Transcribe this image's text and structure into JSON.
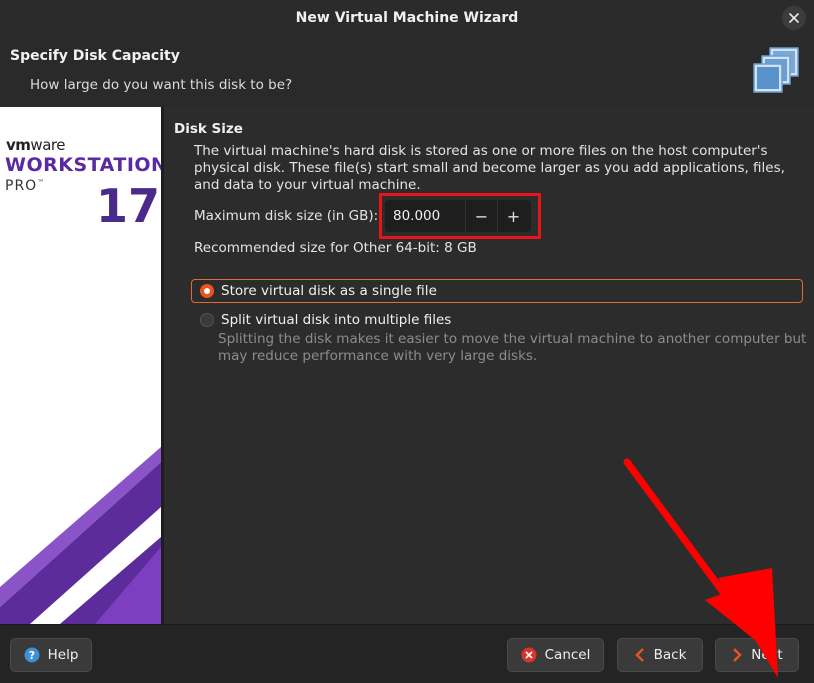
{
  "window": {
    "title": "New Virtual Machine Wizard"
  },
  "header": {
    "title": "Specify Disk Capacity",
    "subtitle": "How large do you want this disk to be?"
  },
  "banner": {
    "brand_bold": "vm",
    "brand_light": "ware",
    "product": "WORKSTATION",
    "edition": "PRO",
    "edition_tm": "™",
    "version": "17"
  },
  "disk": {
    "section_title": "Disk Size",
    "description": "The virtual machine's hard disk is stored as one or more files on the host computer's physical disk. These file(s) start small and become larger as you add applications, files, and data to your virtual machine.",
    "max_size_label": "Maximum disk size (in GB):",
    "max_size_value": "80.000",
    "decrement_symbol": "−",
    "increment_symbol": "+",
    "recommended": "Recommended size for Other 64-bit: 8 GB"
  },
  "options": {
    "single_file_label": "Store virtual disk as a single file",
    "single_file_selected": true,
    "split_label": "Split virtual disk into multiple files",
    "split_selected": false,
    "split_description": "Splitting the disk makes it easier to move the virtual machine to another computer but may reduce performance with very large disks."
  },
  "footer": {
    "help_label": "Help",
    "cancel_label": "Cancel",
    "back_label": "Back",
    "next_label": "Next"
  },
  "icons": {
    "close": "close-icon",
    "disk": "disk-stack-icon",
    "help": "help-icon",
    "cancel": "cancel-icon",
    "back": "chevron-left-icon",
    "next": "chevron-right-icon"
  },
  "colors": {
    "accent": "#e95420",
    "highlight_box": "#e8141c",
    "annotation_arrow": "#ff0000"
  }
}
